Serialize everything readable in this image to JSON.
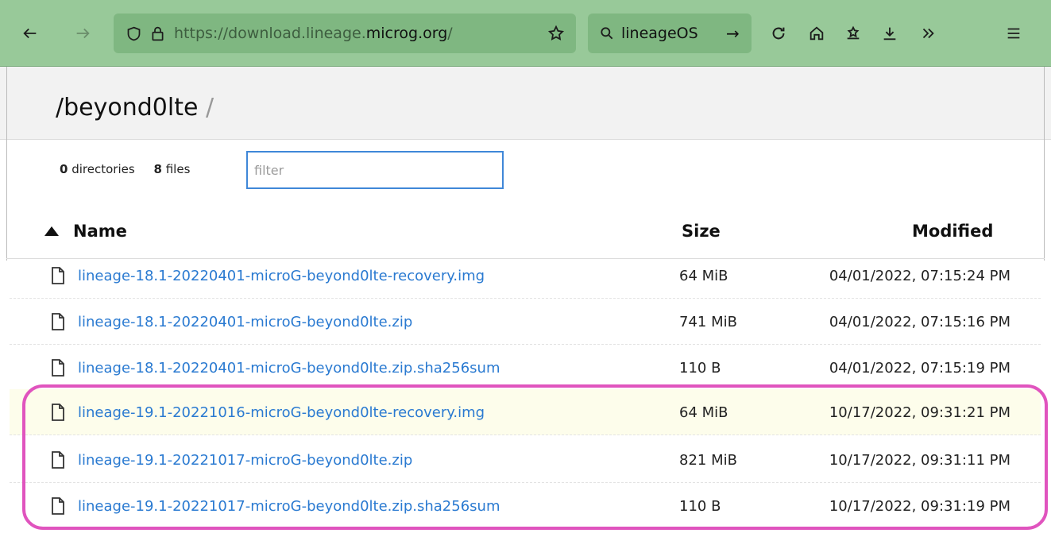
{
  "toolbar": {
    "url_prefix": "https://download.lineage.",
    "url_domain": "microg.org",
    "url_suffix": "/",
    "search_text": "lineageOS"
  },
  "breadcrumb": {
    "sep_start": "/",
    "folder": "beyond0lte",
    "sep_end": "/"
  },
  "summary": {
    "dir_count": "0",
    "dir_label": "directories",
    "file_count": "8",
    "file_label": "files"
  },
  "filter": {
    "placeholder": "filter"
  },
  "columns": {
    "name": "Name",
    "size": "Size",
    "modified": "Modified"
  },
  "files": [
    {
      "name": "lineage-18.1-20220401-microG-beyond0lte-recovery.img",
      "size": "64 MiB",
      "modified": "04/01/2022, 07:15:24 PM"
    },
    {
      "name": "lineage-18.1-20220401-microG-beyond0lte.zip",
      "size": "741 MiB",
      "modified": "04/01/2022, 07:15:16 PM"
    },
    {
      "name": "lineage-18.1-20220401-microG-beyond0lte.zip.sha256sum",
      "size": "110 B",
      "modified": "04/01/2022, 07:15:19 PM"
    },
    {
      "name": "lineage-19.1-20221016-microG-beyond0lte-recovery.img",
      "size": "64 MiB",
      "modified": "10/17/2022, 09:31:21 PM"
    },
    {
      "name": "lineage-19.1-20221017-microG-beyond0lte.zip",
      "size": "821 MiB",
      "modified": "10/17/2022, 09:31:11 PM"
    },
    {
      "name": "lineage-19.1-20221017-microG-beyond0lte.zip.sha256sum",
      "size": "110 B",
      "modified": "10/17/2022, 09:31:19 PM"
    }
  ],
  "colors": {
    "toolbar_bg": "#98c999",
    "link": "#2a7ad1",
    "highlight_row": "#fdfdeb",
    "annotation": "#e054be",
    "filter_border": "#3f87d8"
  }
}
